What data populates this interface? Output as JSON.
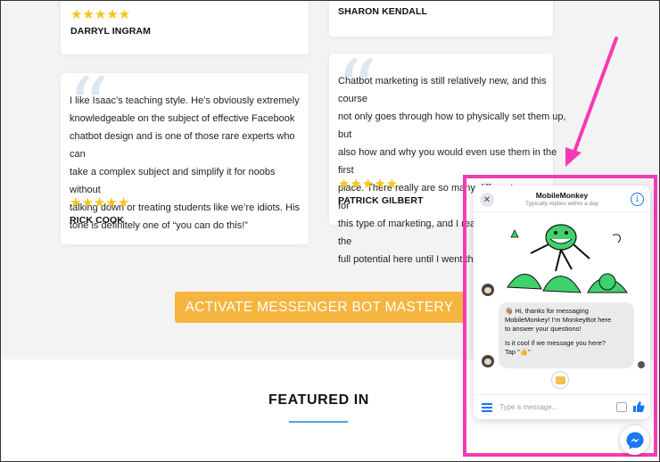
{
  "testimonials": [
    {
      "id": "darryl",
      "stars": "★★★★★",
      "name": "DARRYL INGRAM"
    },
    {
      "id": "sharon",
      "name": "SHARON KENDALL"
    },
    {
      "id": "rick",
      "quote_lines": [
        "I like Isaac’s teaching style. He’s obviously extremely",
        "knowledgeable on the subject of effective Facebook",
        "chatbot design and is one of those rare experts who can",
        "take a complex subject and simplify it for noobs without",
        "talking down or treating students like we’re idiots. His",
        "tone is definitely one of “you can do this!”"
      ],
      "stars": "★★★★★",
      "name": "RICK COOK"
    },
    {
      "id": "patrick",
      "quote_lines": [
        "Chatbot marketing is still relatively new, and this course",
        "not only goes through how to physically set them up, but",
        "also how and why you would even use them in the first",
        "place. There really are so many different use-cases for",
        "this type of marketing, and I really didn't understand the",
        "full potential here until I went through the course."
      ],
      "stars": "★★★★★",
      "name": "PATRICK GILBERT"
    }
  ],
  "cta": {
    "label": "ACTIVATE MESSENGER BOT MASTERY"
  },
  "featured": {
    "title": "FEATURED IN"
  },
  "chat": {
    "title": "MobileMonkey",
    "subtitle": "Typically replies within a day",
    "message_lines": [
      "👋🏽 Hi, thanks for messaging",
      "MobileMonkey! I’m MonkeyBot here",
      "to answer your questions!",
      "",
      "Is it cool if we message you here?",
      "Tap \"👍\""
    ],
    "input_placeholder": "Type a message..."
  },
  "colors": {
    "cta_bg": "#f5b53f",
    "star": "#f5c518",
    "highlight": "#f43bb4",
    "messenger_blue": "#1877f2",
    "featured_underline": "#4aa8e0"
  }
}
